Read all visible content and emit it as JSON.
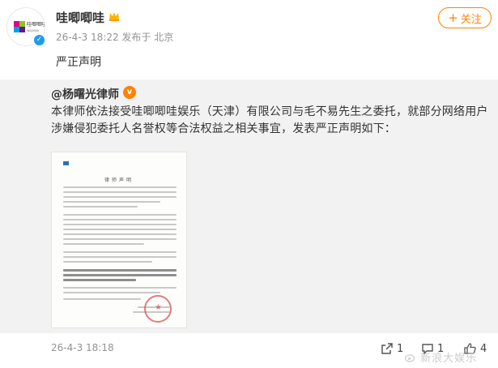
{
  "post": {
    "author": "哇唧唧哇",
    "avatar_brand": "哇唧唧哇",
    "avatar_brand_en": "WAJIJIWA",
    "meta": "26-4-3 18:22 发布于 北京",
    "follow_label": "关注",
    "text": "严正声明"
  },
  "repost": {
    "author": "@杨曙光律师",
    "text": "本律师依法接受哇唧唧哇娱乐（天津）有限公司与毛不易先生之委托，就部分网络用户涉嫌侵犯委托人名誉权等合法权益之相关事宜，发表严正声明如下：",
    "document": {
      "title": "律师声明"
    },
    "time": "26-4-3 18:18",
    "actions": {
      "repost_count": "1",
      "comment_count": "1",
      "like_count": "4"
    }
  },
  "watermark": "新浪大娱乐",
  "colors": {
    "accent": "#ff8200",
    "verified": "#1d9bf0",
    "repost_bg": "#f2f2f2",
    "meta": "#939393"
  },
  "icons": [
    "verified-icon",
    "crown-icon",
    "plus-icon",
    "share-icon",
    "comment-icon",
    "like-icon",
    "weibo-icon"
  ]
}
